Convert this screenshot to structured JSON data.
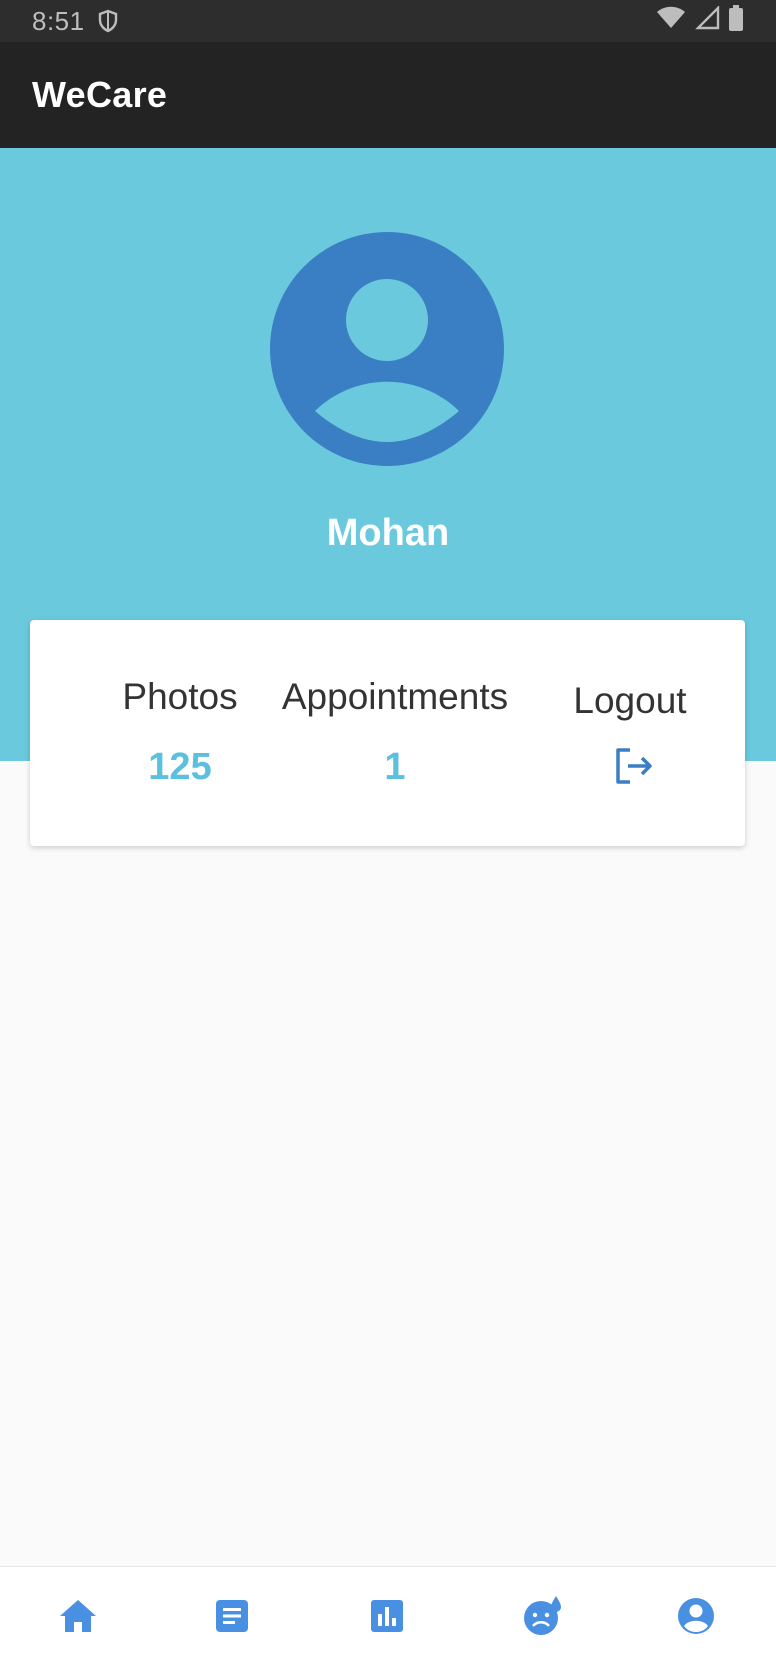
{
  "status_bar": {
    "time": "8:51",
    "icons": [
      "shield-icon",
      "wifi-icon",
      "signal-icon",
      "battery-icon"
    ]
  },
  "app_bar": {
    "title": "WeCare"
  },
  "profile": {
    "name": "Mohan",
    "avatar_icon": "account-circle-icon"
  },
  "stats": {
    "photos_label": "Photos",
    "photos_value": "125",
    "appointments_label": "Appointments",
    "appointments_value": "1",
    "logout_label": "Logout",
    "logout_icon": "logout-icon"
  },
  "bottom_nav": {
    "items": [
      {
        "icon": "home-icon"
      },
      {
        "icon": "document-icon"
      },
      {
        "icon": "bar-chart-icon"
      },
      {
        "icon": "sad-face-icon"
      },
      {
        "icon": "account-circle-icon"
      }
    ]
  },
  "colors": {
    "status_bar": "#2d2d2d",
    "app_bar": "#232323",
    "header_band": "#6bc9de",
    "avatar": "#3a7fc3",
    "stat_value": "#5bc0de",
    "nav_icon": "#4a90e2"
  }
}
